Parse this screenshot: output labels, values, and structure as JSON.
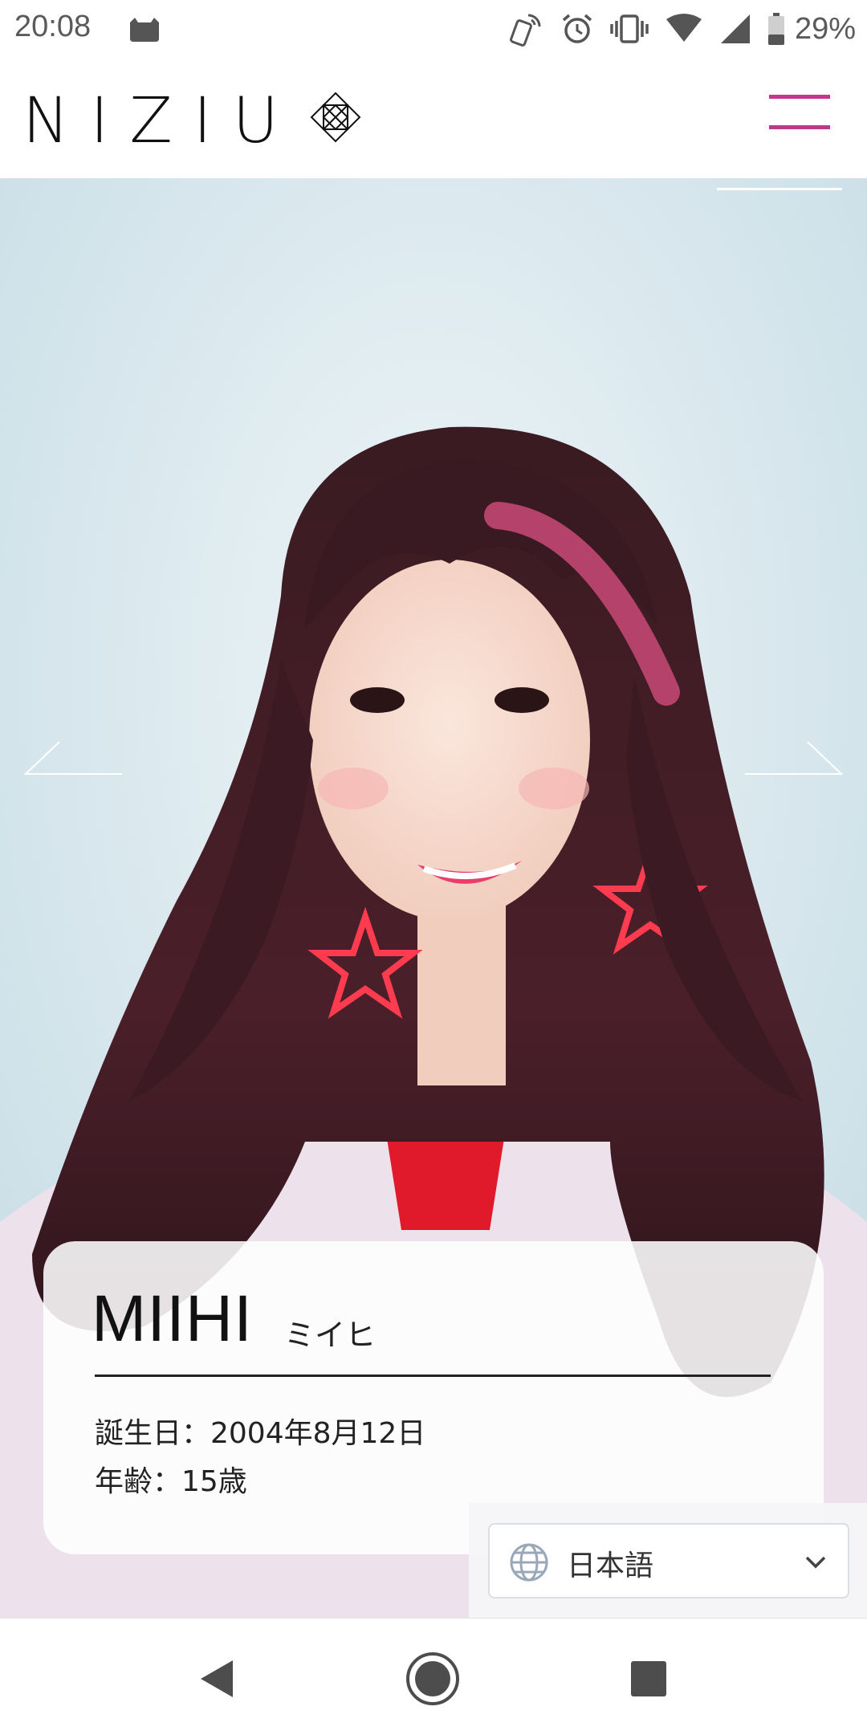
{
  "status_bar": {
    "time": "20:08",
    "battery_percent": "29%",
    "icons": [
      "cat-notification-icon",
      "rotate-phone-icon",
      "alarm-icon",
      "vibrate-icon",
      "wifi-icon",
      "signal-icon",
      "battery-icon"
    ]
  },
  "header": {
    "logo_text": "NIZIU",
    "logo_mark": "diamond-logo-icon",
    "menu_icon": "hamburger-menu-icon",
    "accent_color": "#c2378e"
  },
  "carousel": {
    "prev_icon": "arrow-left-icon",
    "next_icon": "arrow-right-icon",
    "photo": "member-portrait"
  },
  "profile": {
    "name": "MIIHI",
    "kana": "ミイヒ",
    "birthday": "誕生日：2004年8月12日",
    "age": "年齢：15歳"
  },
  "language_selector": {
    "value": "日本語",
    "icon": "globe-icon",
    "dropdown_icon": "chevron-down-icon"
  },
  "nav_bar": {
    "back_icon": "back-triangle-icon",
    "home_icon": "home-circle-icon",
    "recents_icon": "recents-square-icon"
  }
}
